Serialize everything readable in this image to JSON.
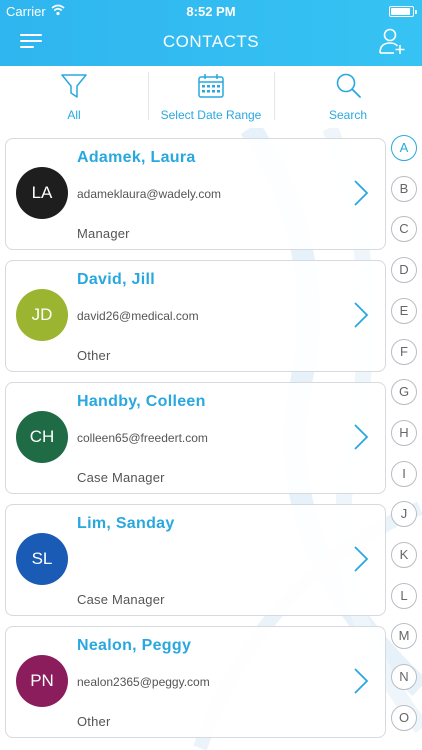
{
  "status_bar": {
    "carrier": "Carrier",
    "time": "8:52 PM"
  },
  "header": {
    "title": "CONTACTS"
  },
  "toolbar": {
    "filter_label": "All",
    "date_range_label": "Select Date Range",
    "search_label": "Search"
  },
  "colors": {
    "accent": "#29a8e0",
    "header": "#33bdf1"
  },
  "contacts": [
    {
      "initials": "LA",
      "name": "Adamek, Laura",
      "email": "adameklaura@wadely.com",
      "role": "Manager",
      "avatar_color": "#1e1e1e"
    },
    {
      "initials": "JD",
      "name": "David, Jill",
      "email": "david26@medical.com",
      "role": "Other",
      "avatar_color": "#9bb531"
    },
    {
      "initials": "CH",
      "name": "Handby, Colleen",
      "email": "colleen65@freedert.com",
      "role": "Case Manager",
      "avatar_color": "#1f6b45"
    },
    {
      "initials": "SL",
      "name": "Lim, Sanday",
      "email": "",
      "role": "Case Manager",
      "avatar_color": "#1a5bb5"
    },
    {
      "initials": "PN",
      "name": "Nealon, Peggy",
      "email": "nealon2365@peggy.com",
      "role": "Other",
      "avatar_color": "#8c1d5c"
    }
  ],
  "alphabet": [
    "A",
    "B",
    "C",
    "D",
    "E",
    "F",
    "G",
    "H",
    "I",
    "J",
    "K",
    "L",
    "M",
    "N",
    "O"
  ],
  "active_letter": "A"
}
